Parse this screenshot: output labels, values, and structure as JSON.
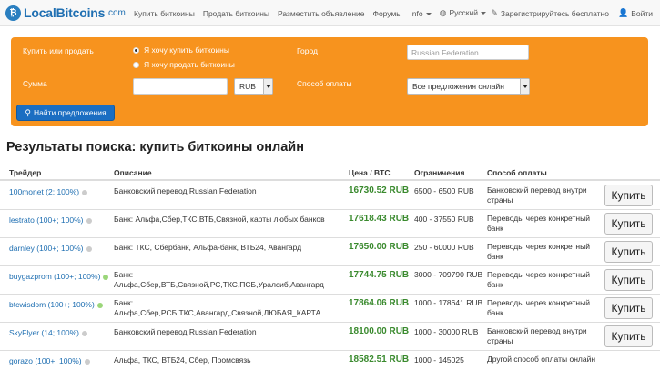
{
  "navbar": {
    "brand": "LocalBitcoins",
    "brand_domain": ".com",
    "links": [
      "Купить биткоины",
      "Продать биткоины",
      "Разместить объявление",
      "Форумы",
      "Info"
    ],
    "language": "Русский",
    "register": "Зарегистрируйтесь бесплатно",
    "login": "Войти"
  },
  "search": {
    "buy_sell_label": "Купить или продать",
    "radio_buy": "Я хочу купить биткоины",
    "radio_sell": "Я хочу продать биткоины",
    "amount_label": "Сумма",
    "amount_value": "",
    "currency": "RUB",
    "city_label": "Город",
    "city_placeholder": "Russian Federation",
    "payment_label": "Способ оплаты",
    "payment_value": "Все предложения онлайн",
    "find_button": "Найти предложения"
  },
  "results": {
    "title": "Результаты поиска: купить биткоины онлайн",
    "headers": [
      "Трейдер",
      "Описание",
      "Цена / BTC",
      "Ограничения",
      "Способ оплаты"
    ],
    "buy_label": "Купить",
    "rows": [
      {
        "trader": "100monet (2; 100%)",
        "online": false,
        "desc": "Банковский перевод Russian Federation",
        "price": "16730.52 RUB",
        "limits": "6500 - 6500 RUB",
        "method": "Банковский перевод внутри страны"
      },
      {
        "trader": "lestrato (100+; 100%)",
        "online": false,
        "desc": "Банк: Альфа,Сбер,ТКС,ВТБ,Связной, карты любых банков",
        "price": "17618.43 RUB",
        "limits": "400 - 37550 RUB",
        "method": "Переводы через конкретный банк"
      },
      {
        "trader": "darnley (100+; 100%)",
        "online": false,
        "desc": "Банк: ТКС, Сбербанк, Альфа-банк, ВТБ24, Авангард",
        "price": "17650.00 RUB",
        "limits": "250 - 60000 RUB",
        "method": "Переводы через конкретный банк"
      },
      {
        "trader": "buygazprom (100+; 100%)",
        "online": true,
        "desc": "Банк: Альфа,Сбер,ВТБ,Связной,РС,ТКС,ПСБ,Уралсиб,Авангард",
        "price": "17744.75 RUB",
        "limits": "3000 - 709790 RUB",
        "method": "Переводы через конкретный банк"
      },
      {
        "trader": "btcwisdom (100+; 100%)",
        "online": true,
        "desc": "Банк: Альфа,Сбер,РСБ,ТКС,Авангард,Связной,ЛЮБАЯ_КАРТА",
        "price": "17864.06 RUB",
        "limits": "1000 - 178641 RUB",
        "method": "Переводы через конкретный банк"
      },
      {
        "trader": "SkyFlyer (14; 100%)",
        "online": false,
        "desc": "Банковский перевод Russian Federation",
        "price": "18100.00 RUB",
        "limits": "1000 - 30000 RUB",
        "method": "Банковский перевод внутри страны"
      },
      {
        "trader": "gorazo (100+; 100%)",
        "online": false,
        "desc": "Альфа, ТКС, ВТБ24, Сбер, Промсвязь",
        "price": "18582.51 RUB",
        "limits": "1000 - 145025",
        "method": "Другой способ оплаты онлайн"
      }
    ]
  },
  "colors": {
    "accent": "#f7931e",
    "link": "#1f6fb2",
    "price": "#3a8a2e",
    "button": "#1b6ec2"
  }
}
